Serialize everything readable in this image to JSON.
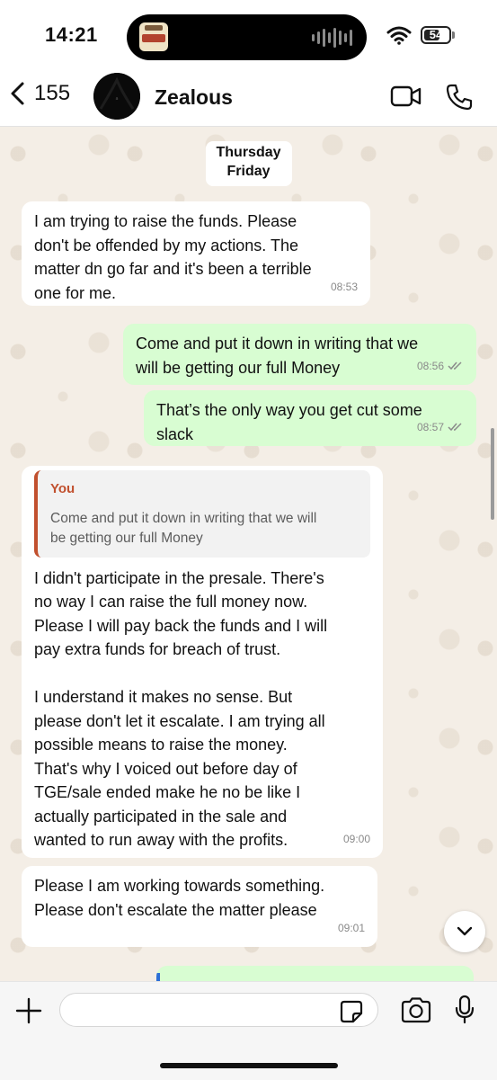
{
  "status_bar": {
    "time": "14:21",
    "battery": "54"
  },
  "header": {
    "back_count": "155",
    "contact_name": "Zealous"
  },
  "date_chips": {
    "thursday": "Thursday",
    "friday": "Friday"
  },
  "messages": [
    {
      "direction": "in",
      "text": "I am trying to raise the funds. Please\ndon't be offended by my actions. The\nmatter dn go far and it's been a terrible\none for me.",
      "time": "08:53"
    },
    {
      "direction": "out",
      "text": "Come and put it down in writing that we\nwill be getting our full Money",
      "time": "08:56"
    },
    {
      "direction": "out",
      "text": "That’s the only way you get cut some\nslack",
      "time": "08:57"
    },
    {
      "direction": "in",
      "quote_author": "You",
      "quote_text": "Come and put it down in writing that we will\nbe getting our full Money",
      "text": "I didn't participate in the presale. There's\nno way I can raise the full money now.\nPlease I will pay back the funds and I will\npay extra funds for breach of trust.\n\nI understand it makes no sense. But\nplease don't let it escalate. I am trying all\npossible means to raise the money.\nThat's why I voiced out before day of\nTGE/sale ended make he no be like I\nactually participated in the sale and\nwanted to run away with the profits.",
      "time": "09:00"
    },
    {
      "direction": "in",
      "text": "Please I am working towards something.\nPlease don't escalate the matter please",
      "time": "09:01"
    }
  ],
  "composer": {
    "value": "",
    "placeholder": ""
  },
  "icons": {
    "back": "chevron-left-icon",
    "video": "video-camera-icon",
    "phone": "phone-icon",
    "plus": "plus-icon",
    "sticker": "sticker-icon",
    "camera": "camera-icon",
    "mic": "microphone-icon",
    "scroll_down": "chevron-down-icon"
  },
  "colors": {
    "incoming_bubble": "#ffffff",
    "outgoing_bubble": "#d8fdd2",
    "quote_accent": "#c1502e",
    "chat_background": "#f4eee6"
  }
}
